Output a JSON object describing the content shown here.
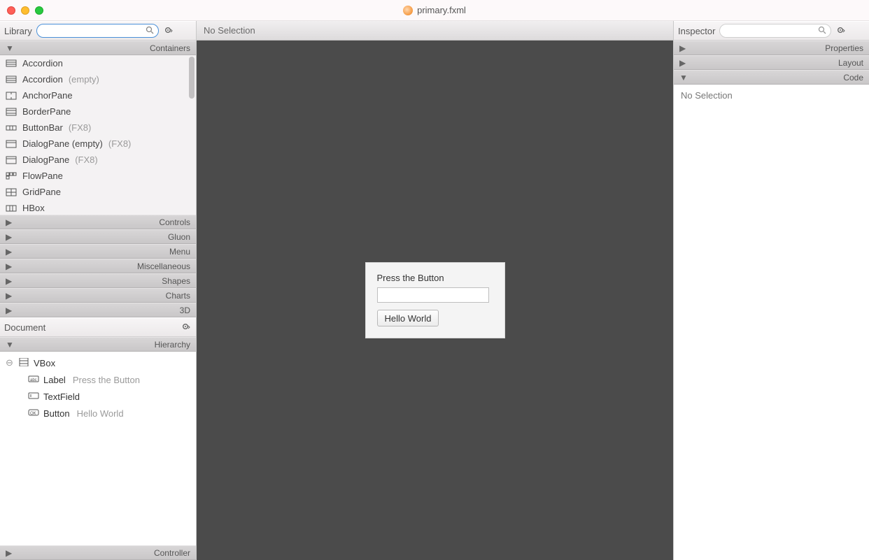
{
  "window": {
    "title": "primary.fxml"
  },
  "library": {
    "title": "Library",
    "search_placeholder": "",
    "sections": {
      "containers": {
        "title": "Containers",
        "expanded": true,
        "items": [
          {
            "label": "Accordion",
            "sub": "",
            "icon": "stack-icon"
          },
          {
            "label": "Accordion",
            "sub": "(empty)",
            "icon": "stack-icon"
          },
          {
            "label": "AnchorPane",
            "sub": "",
            "icon": "anchor-icon"
          },
          {
            "label": "BorderPane",
            "sub": "",
            "icon": "border-icon"
          },
          {
            "label": "ButtonBar",
            "sub": "(FX8)",
            "icon": "buttonbar-icon"
          },
          {
            "label": "DialogPane (empty)",
            "sub": "(FX8)",
            "icon": "dialog-icon"
          },
          {
            "label": "DialogPane",
            "sub": "(FX8)",
            "icon": "dialog-icon"
          },
          {
            "label": "FlowPane",
            "sub": "",
            "icon": "flow-icon"
          },
          {
            "label": "GridPane",
            "sub": "",
            "icon": "grid-icon"
          },
          {
            "label": "HBox",
            "sub": "",
            "icon": "hbox-icon"
          }
        ]
      },
      "collapsed": [
        {
          "title": "Controls"
        },
        {
          "title": "Gluon"
        },
        {
          "title": "Menu"
        },
        {
          "title": "Miscellaneous"
        },
        {
          "title": "Shapes"
        },
        {
          "title": "Charts"
        },
        {
          "title": "3D"
        }
      ]
    }
  },
  "document": {
    "title": "Document",
    "hierarchy_title": "Hierarchy",
    "controller_title": "Controller",
    "tree": {
      "root": {
        "type": "VBox"
      },
      "children": [
        {
          "type": "Label",
          "text": "Press the Button"
        },
        {
          "type": "TextField",
          "text": ""
        },
        {
          "type": "Button",
          "text": "Hello World"
        }
      ]
    }
  },
  "center": {
    "selection_status": "No Selection",
    "preview": {
      "label_text": "Press the Button",
      "textfield_value": "",
      "button_label": "Hello World"
    }
  },
  "inspector": {
    "title": "Inspector",
    "search_placeholder": "",
    "sections": [
      {
        "title": "Properties",
        "expanded": false
      },
      {
        "title": "Layout",
        "expanded": false
      },
      {
        "title": "Code",
        "expanded": true
      }
    ],
    "body_text": "No Selection"
  }
}
